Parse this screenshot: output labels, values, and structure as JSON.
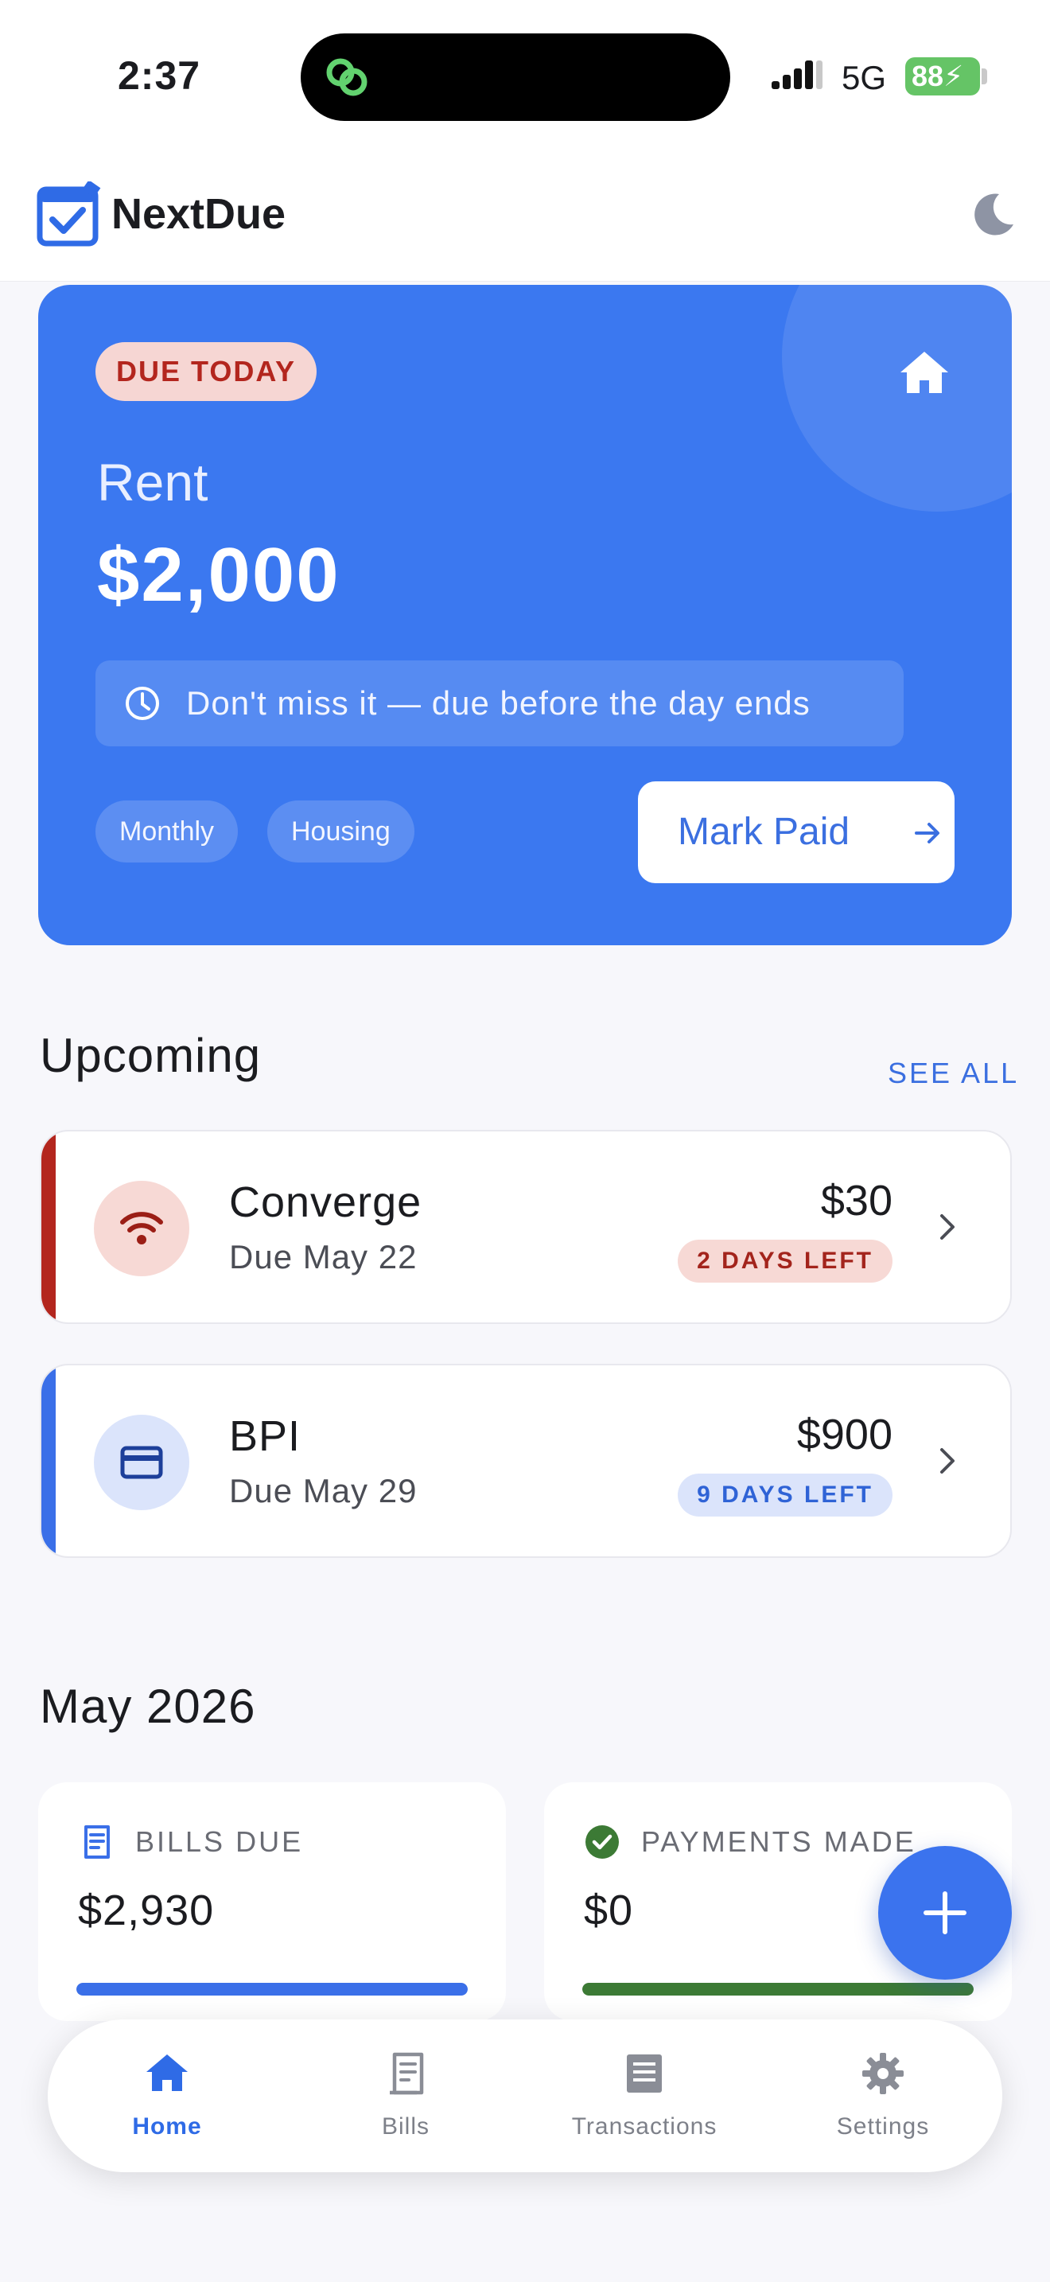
{
  "status_bar": {
    "time": "2:37",
    "network": "5G",
    "battery": "88"
  },
  "header": {
    "app_name": "NextDue",
    "logo_icon": "calendar-check-icon",
    "theme_icon": "moon-icon"
  },
  "hero": {
    "badge": "DUE TODAY",
    "title": "Rent",
    "amount": "$2,000",
    "note": "Don't miss it — due before the day ends",
    "tags": [
      "Monthly",
      "Housing"
    ],
    "action_label": "Mark Paid",
    "category_icon": "home-icon",
    "color": "#3b78f0"
  },
  "upcoming": {
    "title": "Upcoming",
    "see_all_label": "SEE ALL",
    "bills": [
      {
        "name": "Converge",
        "due": "Due May 22",
        "amount": "$30",
        "days_left": "2 DAYS LEFT",
        "icon": "wifi-icon",
        "accent": "#b3261e"
      },
      {
        "name": "BPI",
        "due": "Due May 29",
        "amount": "$900",
        "days_left": "9 DAYS LEFT",
        "icon": "credit-card-icon",
        "accent": "#3a6fe8"
      }
    ]
  },
  "month": {
    "title": "May 2026",
    "stats": [
      {
        "label": "BILLS DUE",
        "value": "$2,930",
        "icon": "receipt-icon",
        "progress": 1.0
      },
      {
        "label": "PAYMENTS MADE",
        "value": "$0",
        "icon": "check-circle-icon",
        "progress": 1.0
      }
    ]
  },
  "fab": {
    "icon": "plus-icon"
  },
  "bottom_nav": {
    "items": [
      {
        "label": "Home",
        "icon": "home-icon",
        "active": true
      },
      {
        "label": "Bills",
        "icon": "receipt-icon",
        "active": false
      },
      {
        "label": "Transactions",
        "icon": "list-icon",
        "active": false
      },
      {
        "label": "Settings",
        "icon": "gear-icon",
        "active": false
      }
    ]
  },
  "colors": {
    "primary": "#3b73ee",
    "danger": "#b3261e",
    "success": "#3c7a35",
    "background": "#f7f7fb"
  }
}
